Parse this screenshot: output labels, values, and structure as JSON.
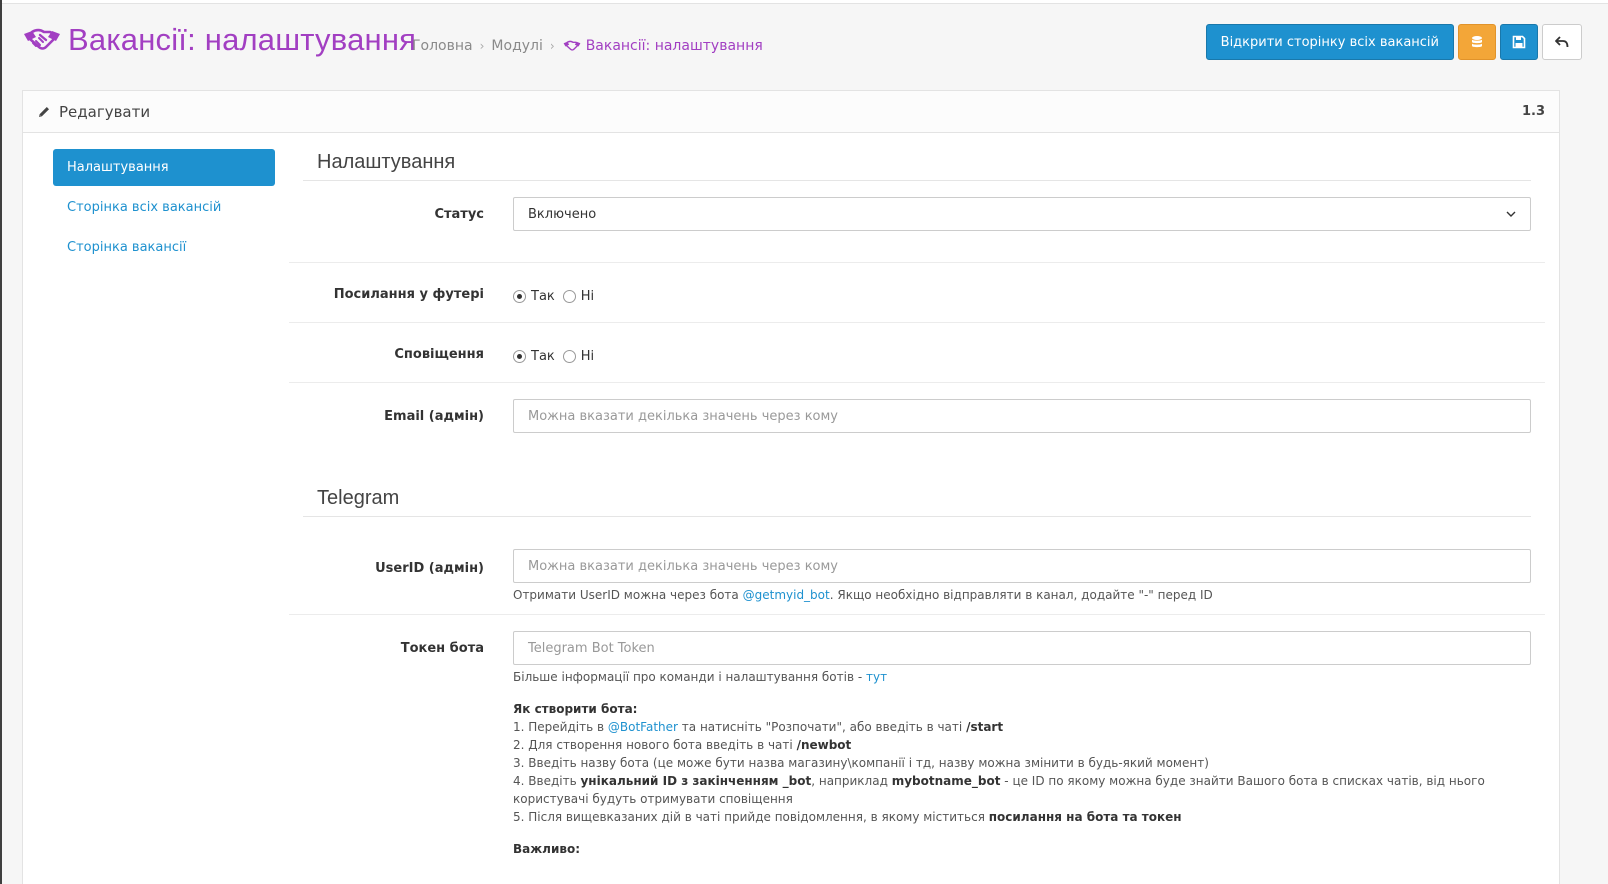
{
  "header": {
    "title": "Вакансії: налаштування",
    "breadcrumbs": [
      "Головна",
      "Модулі",
      "Вакансії: налаштування"
    ],
    "open_all_button": "Відкрити сторінку всіх вакансій"
  },
  "colors": {
    "accent": "#a23fc2",
    "primary": "#1e91cf",
    "warning": "#f3a638"
  },
  "icons": {
    "title": "handshake-icon",
    "panel": "pencil-icon",
    "database": "database-icon",
    "save": "save-icon",
    "back": "reply-icon"
  },
  "panel": {
    "title": "Редагувати",
    "version": "1.3"
  },
  "sidenav": {
    "items": [
      {
        "label": "Налаштування",
        "active": true
      },
      {
        "label": "Сторінка всіх вакансій",
        "active": false
      },
      {
        "label": "Сторінка вакансії",
        "active": false
      }
    ]
  },
  "settings": {
    "legend": "Налаштування",
    "status_label": "Статус",
    "status_value": "Включено",
    "footer_link_label": "Посилання у футері",
    "footer_link_yes": "Так",
    "footer_link_no": "Ні",
    "notifications_label": "Сповіщення",
    "notifications_yes": "Так",
    "notifications_no": "Ні",
    "email_label": "Email (адмін)",
    "email_placeholder": "Можна вказати декілька значень через кому"
  },
  "telegram": {
    "legend": "Telegram",
    "userid_label": "UserID (адмін)",
    "userid_placeholder": "Можна вказати декілька значень через кому",
    "userid_help_pre": "Отримати UserID можна через бота",
    "userid_help_link": "@getmyid_bot",
    "userid_help_post": ". Якщо необхідно відправляти в канал, додайте \"-\" перед ID",
    "token_label": "Токен бота",
    "token_placeholder": "Telegram Bot Token",
    "token_help_pre": "Більше інформації про команди і налаштування ботів -",
    "token_help_link": "тут",
    "howto_title": "Як створити бота:",
    "step1_pre": "1. Перейдіть в",
    "step1_link": "@BotFather",
    "step1_mid": "та натисніть \"Розпочати\", або введіть в чаті",
    "step1_cmd": "/start",
    "step2_pre": "2. Для створення нового бота введіть в чаті",
    "step2_cmd": "/newbot",
    "step3": "3. Введіть назву бота (це може бути назва магазину\\компанії і тд, назву можна змінити в будь-який момент)",
    "step4_pre": "4. Введіть",
    "step4_bold1": "унікальний ID з закінченням _bot",
    "step4_mid": ", наприклад",
    "step4_bold2": "mybotname_bot",
    "step4_post": "- це ID по якому можна буде знайти Вашого бота в списках чатів, від нього користувачі будуть отримувати сповіщення",
    "step5_pre": "5. Після вищевказаних дій в чаті прийде повідомлення, в якому міститься",
    "step5_bold": "посилання на бота та токен",
    "important_title": "Важливо:"
  }
}
